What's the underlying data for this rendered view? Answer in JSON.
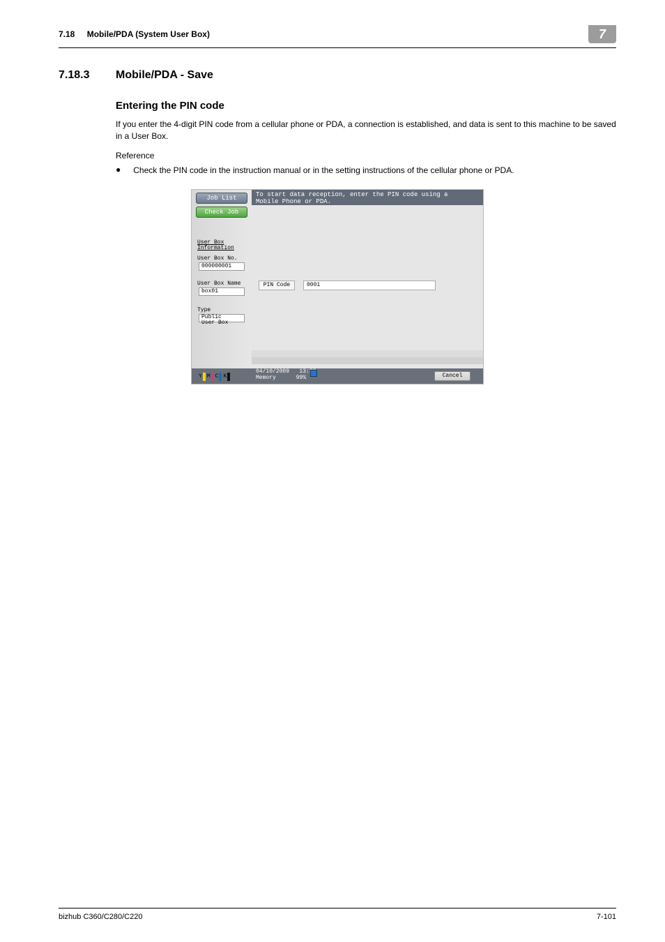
{
  "header": {
    "section_no": "7.18",
    "section_title": "Mobile/PDA (System User Box)",
    "chapter_no": "7"
  },
  "heading": {
    "number": "7.18.3",
    "title": "Mobile/PDA -  Save"
  },
  "subheading": "Entering the PIN code",
  "body_para": "If you enter the 4-digit PIN code from a cellular phone or PDA, a connection is established, and data is sent to this machine to be saved in a User Box.",
  "reference_label": "Reference",
  "bullet_text": "Check the PIN code in the instruction manual or in the setting instructions of the cellular phone or PDA.",
  "screenshot": {
    "job_list": "Job List",
    "check_job": "Check Job",
    "top_msg_line1": "To start data reception, enter the PIN code using a",
    "top_msg_line2": "Mobile Phone or PDA.",
    "info_head_line1": "User Box",
    "info_head_line2": "Information",
    "box_no_label": "User Box No.",
    "box_no_value": "000000001",
    "box_name_label": "User Box Name",
    "box_name_value": "box01",
    "type_label": "Type",
    "type_value_line1": "Public",
    "type_value_line2": "User Box",
    "pin_label": "PIN Code",
    "pin_value": "0001",
    "cancel": "Cancel",
    "date": "04/10/2009",
    "time": "13:33",
    "memory_label": "Memory",
    "memory_value": "99%",
    "toners": {
      "y": "Y",
      "m": "M",
      "c": "C",
      "k": "K"
    }
  },
  "footer": {
    "product": "bizhub C360/C280/C220",
    "page": "7-101"
  }
}
